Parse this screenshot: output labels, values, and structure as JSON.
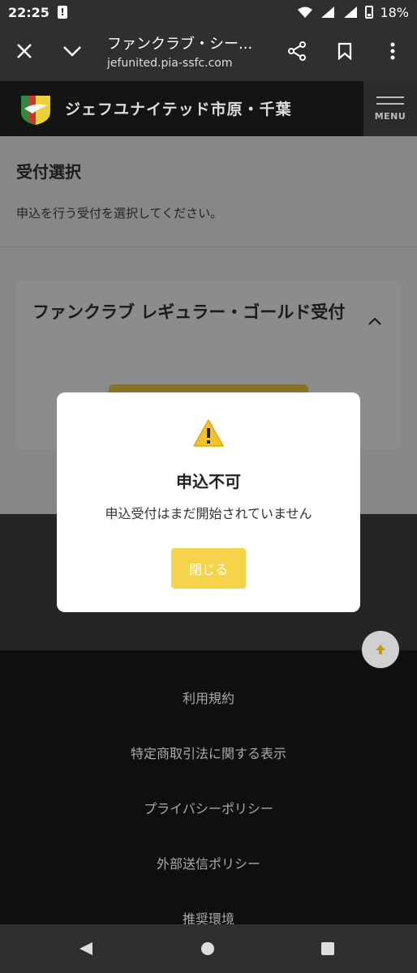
{
  "status_bar": {
    "time": "22:25",
    "battery": "18%"
  },
  "browser": {
    "title": "ファンクラブ・シー...",
    "url": "jefunited.pia-ssfc.com"
  },
  "site_header": {
    "club_name": "ジェフユナイテッド市原・千葉",
    "menu_label": "MENU"
  },
  "page": {
    "section_title": "受付選択",
    "section_desc": "申込を行う受付を選択してください。",
    "card_title": "ファンクラブ レギュラー・ゴールド受付"
  },
  "modal": {
    "title": "申込不可",
    "message": "申込受付はまだ開始されていません",
    "close_label": "閉じる"
  },
  "footer": {
    "links": [
      "利用規約",
      "特定商取引法に関する表示",
      "プライバシーポリシー",
      "外部送信ポリシー",
      "推奨環境"
    ]
  },
  "colors": {
    "accent": "#f5d34a",
    "header_bg": "#141414",
    "browser_bg": "#2f2f2f"
  }
}
